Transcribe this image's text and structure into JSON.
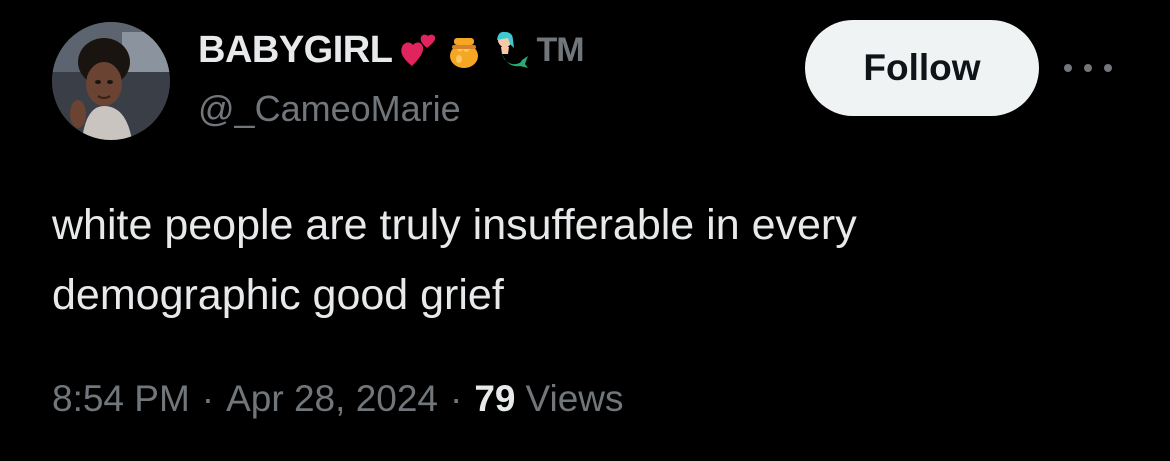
{
  "tweet": {
    "display_name": "BABYGIRL",
    "name_emojis": [
      "two-hearts-icon",
      "honey-pot-icon",
      "mermaid-icon"
    ],
    "name_suffix": "TM",
    "handle": "@_CameoMarie",
    "follow_label": "Follow",
    "more_icon": "more-dots-icon",
    "text_line1": "white people are truly insufferable in every",
    "text_line2": "demographic good grief",
    "time": "8:54 PM",
    "separator": "·",
    "date": "Apr 28, 2024",
    "views_count": "79",
    "views_label": "Views"
  },
  "colors": {
    "background": "#000000",
    "primary_text": "#e7e9ea",
    "secondary_text": "#71767b",
    "follow_bg": "#eff3f4",
    "follow_text": "#0f1419"
  }
}
